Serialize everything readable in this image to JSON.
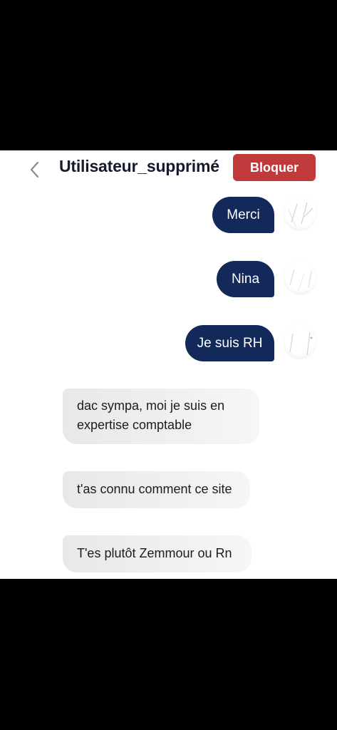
{
  "header": {
    "back_icon": "chevron-left-icon",
    "title": "Utilisateur_supprimé",
    "block_label": "Bloquer",
    "block_color": "#c0393b"
  },
  "messages": [
    {
      "direction": "outgoing",
      "text": "Merci"
    },
    {
      "direction": "outgoing",
      "text": "Nina"
    },
    {
      "direction": "outgoing",
      "text": "Je suis RH"
    },
    {
      "direction": "incoming",
      "text": "dac sympa,  moi je suis en expertise comptable"
    },
    {
      "direction": "incoming",
      "text": "t'as connu comment ce site"
    },
    {
      "direction": "incoming",
      "text": "T'es plutôt Zemmour ou Rn"
    }
  ],
  "colors": {
    "outgoing_bubble": "#13295a",
    "incoming_bubble": "#eeeeee"
  }
}
